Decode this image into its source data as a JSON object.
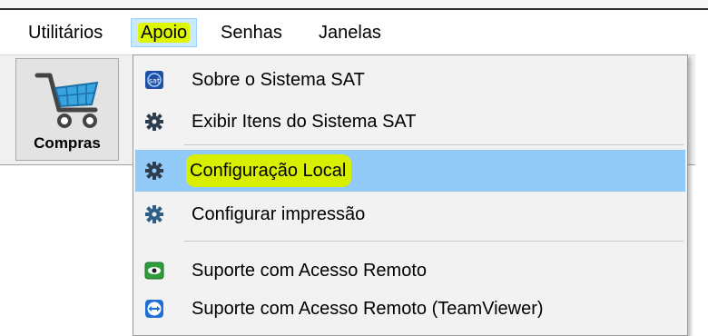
{
  "menubar": {
    "items": [
      {
        "label": "Utilitários"
      },
      {
        "label": "Apoio"
      },
      {
        "label": "Senhas"
      },
      {
        "label": "Janelas"
      }
    ]
  },
  "toolbar": {
    "compras_label": "Compras",
    "compras_icon": "shopping-cart-icon"
  },
  "dropdown": {
    "items": [
      {
        "label": "Sobre o Sistema SAT",
        "icon": "sat-logo-icon"
      },
      {
        "label": "Exibir Itens do Sistema SAT",
        "icon": "gear-icon"
      },
      {
        "label": "Configuração Local",
        "icon": "gear-icon",
        "selected": true
      },
      {
        "label": "Configurar impressão",
        "icon": "gear-icon"
      },
      {
        "label": "Suporte com Acesso Remoto",
        "icon": "remote-eye-icon"
      },
      {
        "label": "Suporte com Acesso Remoto (TeamViewer)",
        "icon": "teamviewer-icon"
      }
    ]
  },
  "colors": {
    "selection": "#91c9f7",
    "highlighter": "#d8f000",
    "menu_active": "#cce8ff"
  }
}
